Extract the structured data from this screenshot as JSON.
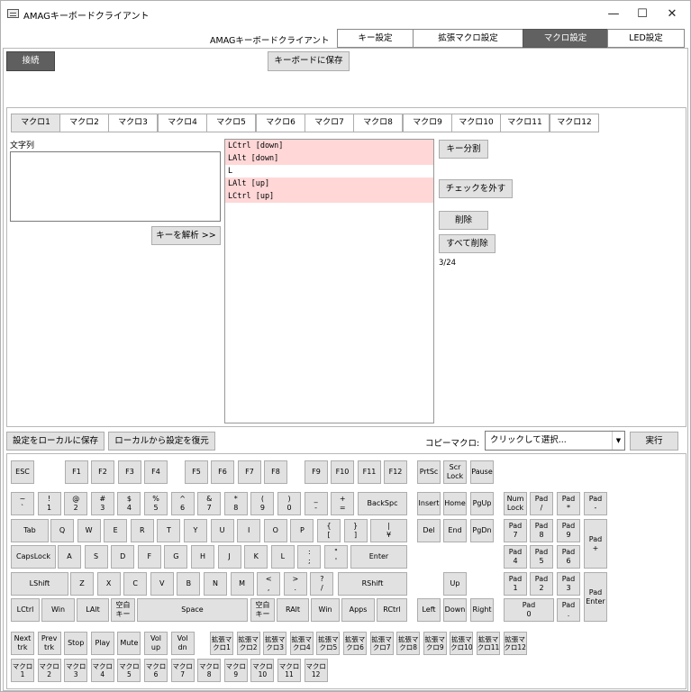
{
  "window": {
    "title": "AMAGキーボードクライアント"
  },
  "header": {
    "app_label": "AMAGキーボードクライアント",
    "tabs": [
      "キー設定",
      "拡張マクロ設定",
      "マクロ設定",
      "LED設定"
    ]
  },
  "toolbar": {
    "connect": "接続",
    "save_to_keyboard": "キーボードに保存"
  },
  "macro": {
    "tabs": [
      "マクロ1",
      "マクロ2",
      "マクロ3",
      "マクロ4",
      "マクロ5",
      "マクロ6",
      "マクロ7",
      "マクロ8",
      "マクロ9",
      "マクロ10",
      "マクロ11",
      "マクロ12"
    ],
    "string_label": "文字列",
    "string_value": "",
    "analyze_button": "キーを解析 >>",
    "list": [
      {
        "text": "LCtrl [down]",
        "checked": true
      },
      {
        "text": "LAlt [down]",
        "checked": true
      },
      {
        "text": "L",
        "checked": false
      },
      {
        "text": "LAlt [up]",
        "checked": true
      },
      {
        "text": "LCtrl [up]",
        "checked": true
      }
    ],
    "buttons": {
      "split": "キー分割",
      "uncheck": "チェックを外す",
      "delete": "削除",
      "delete_all": "すべて削除"
    },
    "count": "3/24"
  },
  "bottom": {
    "save_local": "設定をローカルに保存",
    "restore_local": "ローカルから設定を復元",
    "copy_label": "コピーマクロ:",
    "copy_placeholder": "クリックして選択...",
    "run": "実行"
  },
  "keys": {
    "esc": "ESC",
    "f1": "F1",
    "f2": "F2",
    "f3": "F3",
    "f4": "F4",
    "f5": "F5",
    "f6": "F6",
    "f7": "F7",
    "f8": "F8",
    "f9": "F9",
    "f10": "F10",
    "f11": "F11",
    "f12": "F12",
    "prtsc": "PrtSc",
    "scrlock": "Scr\nLock",
    "pause": "Pause",
    "grave": "~\n`",
    "n1": "!\n1",
    "n2": "@\n2",
    "n3": "#\n3",
    "n4": "$\n4",
    "n5": "%\n5",
    "n6": "^\n6",
    "n7": "&\n7",
    "n8": "*\n8",
    "n9": "(\n9",
    "n0": ")\n0",
    "minus": "_\n-",
    "equal": "+\n=",
    "backspace": "BackSpc",
    "insert": "Insert",
    "home": "Home",
    "pgup": "PgUp",
    "numlock": "Num\nLock",
    "pad_div": "Pad\n/",
    "pad_mul": "Pad\n*",
    "pad_sub": "Pad\n-",
    "tab": "Tab",
    "q": "Q",
    "w": "W",
    "e": "E",
    "r": "R",
    "t": "T",
    "y": "Y",
    "u": "U",
    "i": "I",
    "o": "O",
    "p": "P",
    "lbracket": "{\n[",
    "rbracket": "}\n]",
    "yen": "|\n¥",
    "del": "Del",
    "end": "End",
    "pgdn": "PgDn",
    "pad7": "Pad\n7",
    "pad8": "Pad\n8",
    "pad9": "Pad\n9",
    "pad_add": "Pad\n+",
    "capslock": "CapsLock",
    "a": "A",
    "s": "S",
    "d": "D",
    "f": "F",
    "g": "G",
    "h": "H",
    "j": "J",
    "k": "K",
    "l": "L",
    "semicolon": ":\n;",
    "quote": "\"\n'",
    "enter": "Enter",
    "pad4": "Pad\n4",
    "pad5": "Pad\n5",
    "pad6": "Pad\n6",
    "lshift": "LShift",
    "z": "Z",
    "x": "X",
    "c": "C",
    "v": "V",
    "b": "B",
    "n": "N",
    "m": "M",
    "comma": "<\n,",
    "period": ">\n.",
    "slash": "?\n/",
    "rshift": "RShift",
    "up": "Up",
    "pad1": "Pad\n1",
    "pad2": "Pad\n2",
    "pad3": "Pad\n3",
    "pad_enter": "Pad\nEnter",
    "lctrl": "LCtrl",
    "lwin": "Win",
    "lalt": "LAlt",
    "space_l": "空白\nキー",
    "space": "Space",
    "space_r": "空白\nキー",
    "ralt": "RAlt",
    "rwin": "Win",
    "apps": "Apps",
    "rctrl": "RCtrl",
    "left": "Left",
    "down": "Down",
    "right": "Right",
    "pad0": "Pad\n0",
    "pad_dot": "Pad\n.",
    "next": "Next\ntrk",
    "prev": "Prev\ntrk",
    "stop": "Stop",
    "play": "Play",
    "mute": "Mute",
    "volup": "Vol\nup",
    "voldn": "Vol\ndn",
    "ext": [
      "拡張マ\nクロ1",
      "拡張マ\nクロ2",
      "拡張マ\nクロ3",
      "拡張マ\nクロ4",
      "拡張マ\nクロ5",
      "拡張マ\nクロ6",
      "拡張マ\nクロ7",
      "拡張マ\nクロ8",
      "拡張マ\nクロ9",
      "拡張マ\nクロ10",
      "拡張マ\nクロ11",
      "拡張マ\nクロ12"
    ],
    "mac": [
      "マクロ\n1",
      "マクロ\n2",
      "マクロ\n3",
      "マクロ\n4",
      "マクロ\n5",
      "マクロ\n6",
      "マクロ\n7",
      "マクロ\n8",
      "マクロ\n9",
      "マクロ\n10",
      "マクロ\n11",
      "マクロ\n12"
    ]
  }
}
